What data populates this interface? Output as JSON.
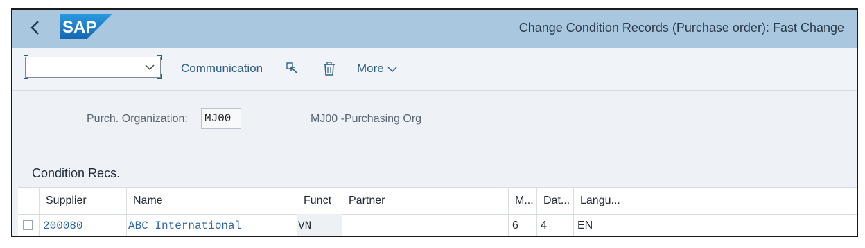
{
  "shell": {
    "title": "Change Condition Records (Purchase order): Fast Change",
    "logo_text": "SAP",
    "colors": {
      "shell_bg": "#a9c7df",
      "logo_blue": "#1979c3"
    }
  },
  "toolbar": {
    "command_field_value": "",
    "communication_label": "Communication",
    "select_icon": "cursor-select-icon",
    "delete_icon": "trash-icon",
    "more_label": "More"
  },
  "selection": {
    "label": "Purch. Organization:",
    "value": "MJ00",
    "description": "MJ00 -Purchasing Org"
  },
  "section": {
    "title": "Condition Recs."
  },
  "table": {
    "columns": [
      "Supplier",
      "Name",
      "Funct",
      "Partner",
      "M...",
      "Dat...",
      "Langu..."
    ],
    "rows": [
      {
        "supplier": "200080",
        "name": "ABC International",
        "funct": "VN",
        "partner": "",
        "m": "6",
        "dat": "4",
        "lang": "EN"
      }
    ]
  }
}
